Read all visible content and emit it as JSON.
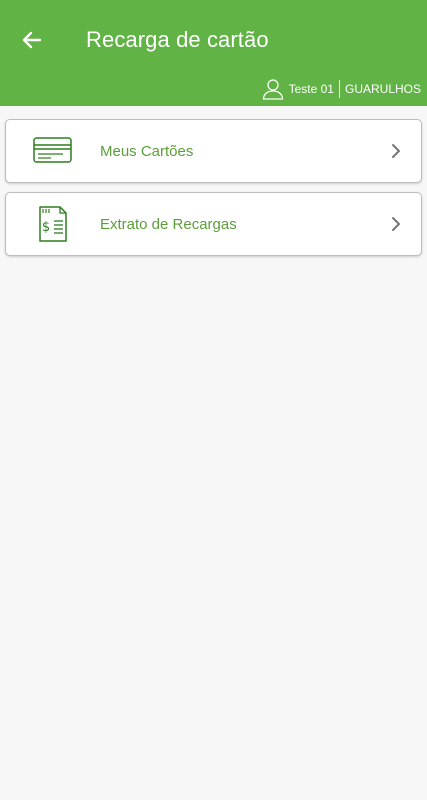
{
  "header": {
    "title": "Recarga de cartão",
    "back_icon": "arrow-left-icon",
    "user_icon": "user-outline-icon",
    "user_name": "Teste 01",
    "city": "GUARULHOS"
  },
  "menu": {
    "items": [
      {
        "label": "Meus Cartões",
        "icon": "credit-card-icon"
      },
      {
        "label": "Extrato de Recargas",
        "icon": "receipt-dollar-icon"
      }
    ]
  },
  "colors": {
    "header_bg": "#62b346",
    "label_green": "#5c9e3a",
    "page_bg": "#f7f7f7"
  }
}
